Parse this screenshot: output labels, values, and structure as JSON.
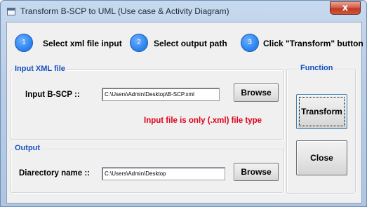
{
  "window": {
    "title": "Transform B-SCP to UML (Use case & Activity Diagram)",
    "close_glyph": "x"
  },
  "steps": [
    {
      "number": "1",
      "label": "Select xml file input"
    },
    {
      "number": "2",
      "label": "Select output path"
    },
    {
      "number": "3",
      "label": "Click \"Transform\" button"
    }
  ],
  "input_group": {
    "title": "Input XML file",
    "field_label": "Input B-SCP ::",
    "path_value": "C:\\Users\\Admin\\Desktop\\B-SCP.xml",
    "browse_label": "Browse",
    "warning": "Input file is only (.xml) file type"
  },
  "output_group": {
    "title": "Output",
    "field_label": "Diarectory name ::",
    "path_value": "C:\\Users\\Admin\\Desktop",
    "browse_label": "Browse"
  },
  "function_group": {
    "title": "Function",
    "transform_label": "Transform",
    "close_label": "Close"
  },
  "colors": {
    "step_circle": "#2f86f0",
    "group_title": "#1550c0",
    "warning": "#e0001b"
  }
}
